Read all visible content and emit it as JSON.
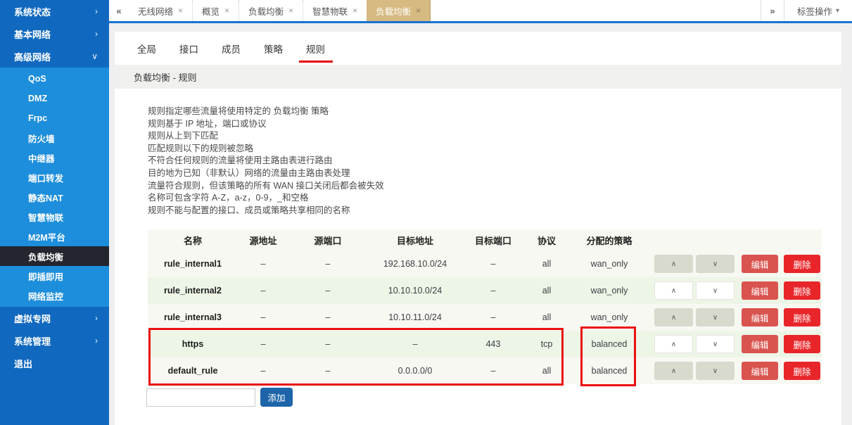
{
  "colors": {
    "sidebar_bg": "#1169bf",
    "submenu_bg": "#1d8edb",
    "selected_bg": "#23262e",
    "topbar_line": "#1673cf",
    "active_tab_bg": "#d6ba82",
    "subtab_underline": "#e60000",
    "edit_btn": "#d9534f",
    "delete_btn": "#e8262a",
    "add_btn": "#1d64a8",
    "annotation_red": "#ea1010"
  },
  "sidebar": {
    "top_items": [
      {
        "label": "系统状态",
        "arrow": "›"
      },
      {
        "label": "基本网络",
        "arrow": "›"
      },
      {
        "label": "高级网络",
        "arrow": "∨"
      }
    ],
    "submenu_items": [
      {
        "label": "QoS"
      },
      {
        "label": "DMZ"
      },
      {
        "label": "Frpc"
      },
      {
        "label": "防火墙"
      },
      {
        "label": "中继器"
      },
      {
        "label": "端口转发"
      },
      {
        "label": "静态NAT"
      },
      {
        "label": "智慧物联"
      },
      {
        "label": "M2M平台"
      },
      {
        "label": "负载均衡"
      },
      {
        "label": "即插即用"
      },
      {
        "label": "网络监控"
      }
    ],
    "selected_submenu": "负载均衡",
    "bottom_items": [
      {
        "label": "虚拟专网",
        "arrow": "›"
      },
      {
        "label": "系统管理",
        "arrow": "›"
      },
      {
        "label": "退出",
        "arrow": ""
      }
    ]
  },
  "tabbar": {
    "scroll_left_icon": "«",
    "scroll_right_icon": "»",
    "close_icon": "×",
    "tabs": [
      {
        "label": "无线网络"
      },
      {
        "label": "概览"
      },
      {
        "label": "负载均衡"
      },
      {
        "label": "智慧物联"
      },
      {
        "label": "负载均衡"
      }
    ],
    "active_tab_index": 4,
    "menu_label": "标签操作",
    "menu_arrow": "▾"
  },
  "panel": {
    "subtabs": [
      "全局",
      "接口",
      "成员",
      "策略",
      "规则"
    ],
    "active_subtab": "规则",
    "breadcrumb": "负载均衡 - 规则",
    "description_lines": [
      "规则指定哪些流量将使用特定的 负载均衡 策略",
      "规则基于 IP 地址，端口或协议",
      "规则从上到下匹配",
      "匹配规则以下的规则被忽略",
      "不符合任何规则的流量将使用主路由表进行路由",
      "目的地为已知（非默认）网络的流量由主路由表处理",
      "流量符合规则，但该策略的所有 WAN 接口关闭后都会被失效",
      "名称可包含字符 A-Z，a-z，0-9，_和空格",
      "规则不能与配置的接口、成员或策略共享相同的名称"
    ]
  },
  "table": {
    "headers": [
      "名称",
      "源地址",
      "源端口",
      "目标地址",
      "目标端口",
      "协议",
      "分配的策略"
    ],
    "rows": [
      {
        "name": "rule_internal1",
        "src_addr": "–",
        "src_port": "–",
        "dst_addr": "192.168.10.0/24",
        "dst_port": "–",
        "proto": "all",
        "policy": "wan_only"
      },
      {
        "name": "rule_internal2",
        "src_addr": "–",
        "src_port": "–",
        "dst_addr": "10.10.10.0/24",
        "dst_port": "–",
        "proto": "all",
        "policy": "wan_only"
      },
      {
        "name": "rule_internal3",
        "src_addr": "–",
        "src_port": "–",
        "dst_addr": "10.10.11.0/24",
        "dst_port": "–",
        "proto": "all",
        "policy": "wan_only"
      },
      {
        "name": "https",
        "src_addr": "–",
        "src_port": "–",
        "dst_addr": "–",
        "dst_port": "443",
        "proto": "tcp",
        "policy": "balanced"
      },
      {
        "name": "default_rule",
        "src_addr": "–",
        "src_port": "–",
        "dst_addr": "0.0.0.0/0",
        "dst_port": "–",
        "proto": "all",
        "policy": "balanced"
      }
    ],
    "up_glyph": "∧",
    "down_glyph": "∨",
    "edit_label": "编辑",
    "delete_label": "删除"
  },
  "add": {
    "input_value": "",
    "button_label": "添加"
  }
}
